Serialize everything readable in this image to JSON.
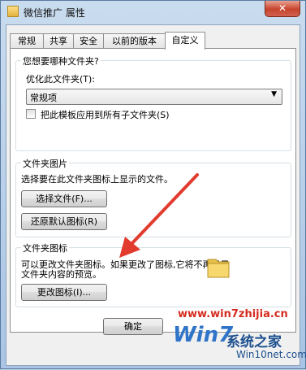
{
  "window": {
    "title": "微信推广 属性",
    "close_glyph": "✕"
  },
  "tabs": [
    {
      "label": "常规"
    },
    {
      "label": "共享"
    },
    {
      "label": "安全"
    },
    {
      "label": "以前的版本"
    },
    {
      "label": "自定义"
    }
  ],
  "optimize_group": {
    "title": "您想要哪种文件夹?",
    "optimize_label": "优化此文件夹(T):",
    "combo_value": "常规项",
    "apply_checkbox_label": "把此模板应用到所有子文件夹(S)",
    "apply_checked": false
  },
  "folder_picture_group": {
    "title": "文件夹图片",
    "description": "选择要在此文件夹图标上显示的文件。",
    "choose_file_button": "选择文件(F)...",
    "restore_default_button": "还原默认图标(R)"
  },
  "folder_icon_group": {
    "title": "文件夹图标",
    "description_line1": "可以更改文件夹图标。如果更改了图标,它将不再显示",
    "description_line2": "文件夹内容的预览。",
    "change_icon_button": "更改图标(I)..."
  },
  "footer": {
    "ok_button": "确定"
  },
  "watermark": {
    "url_line": "www.win7zhijia.cn",
    "logo_text": "Win7",
    "site_name": "系统之家",
    "site_url": "Win10net.com"
  },
  "colors": {
    "annotation_arrow": "#e23b2e",
    "titlebar": "#b9d1ea"
  }
}
